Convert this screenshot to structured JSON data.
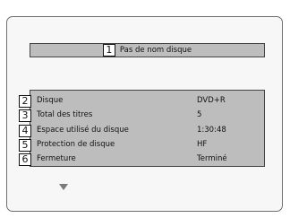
{
  "title_bar": {
    "number": "1",
    "text": "Pas de nom disque"
  },
  "info_rows": [
    {
      "number": "2",
      "label": "Disque",
      "value": "DVD+R"
    },
    {
      "number": "3",
      "label": "Total des titres",
      "value": "5"
    },
    {
      "number": "4",
      "label": "Espace utilisé du disque",
      "value": "1:30:48"
    },
    {
      "number": "5",
      "label": "Protection de disque",
      "value": "HF"
    },
    {
      "number": "6",
      "label": "Fermeture",
      "value": "Terminé"
    }
  ],
  "icons": {
    "scroll_down": "down-arrow-icon"
  },
  "colors": {
    "panel_background": "#bdbdbd",
    "screen_background": "#f7f7f7",
    "arrow": "#7a7a7a"
  }
}
